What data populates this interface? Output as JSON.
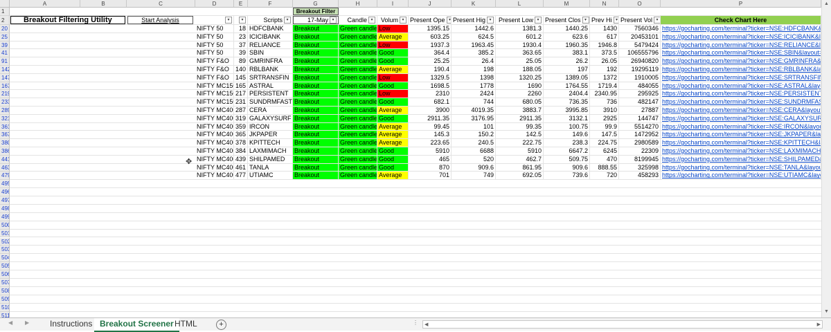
{
  "columns": [
    "A",
    "B",
    "C",
    "D",
    "E",
    "F",
    "G",
    "H",
    "I",
    "J",
    "K",
    "L",
    "M",
    "N",
    "O",
    "P"
  ],
  "row1": {
    "num": "1",
    "breakout_filter": "Breakout Filter"
  },
  "row2": {
    "num": "2",
    "title": "Breakout Filtering Utility",
    "start_button": "Start Analysis",
    "scripts_header": "Scripts",
    "date_header": "17-May",
    "candle_header": "Candle",
    "volume_header": "Volum",
    "open_header": "Present Ope",
    "high_header": "Present Hig",
    "low_header": "Present Low",
    "close_header": "Present Clos",
    "prevhigh_header": "Prev Hi",
    "vol_header": "Present Vol",
    "chart_header": "Check Chart Here"
  },
  "rows": [
    {
      "num": "20",
      "index": "NIFTY 50",
      "n": "18",
      "sym": "HDFCBANK",
      "status": "Breakout",
      "candle": "Green candle",
      "vol": "Low",
      "vc": "red",
      "open": "1395.15",
      "high": "1442.6",
      "low": "1381.3",
      "close": "1440.25",
      "prev": "1430",
      "pvol": "7560346",
      "link": "https://gocharting.com/terminal?ticker=NSE:HDFCBANK&la"
    },
    {
      "num": "25",
      "index": "NIFTY 50",
      "n": "23",
      "sym": "ICICIBANK",
      "status": "Breakout",
      "candle": "Green candle",
      "vol": "Average",
      "vc": "yellow",
      "open": "603.25",
      "high": "624.5",
      "low": "601.2",
      "close": "623.6",
      "prev": "617",
      "pvol": "20453101",
      "link": "https://gocharting.com/terminal?ticker=NSE:ICICIBANK&la"
    },
    {
      "num": "39",
      "index": "NIFTY 50",
      "n": "37",
      "sym": "RELIANCE",
      "status": "Breakout",
      "candle": "Green candle",
      "vol": "Low",
      "vc": "red",
      "open": "1937.3",
      "high": "1963.45",
      "low": "1930.4",
      "close": "1960.35",
      "prev": "1946.8",
      "pvol": "5479424",
      "link": "https://gocharting.com/terminal?ticker=NSE:RELIANCE&lay"
    },
    {
      "num": "41",
      "index": "NIFTY 50",
      "n": "39",
      "sym": "SBIN",
      "status": "Breakout",
      "candle": "Green candle",
      "vol": "Good",
      "vc": "green",
      "open": "364.4",
      "high": "385.2",
      "low": "363.65",
      "close": "383.1",
      "prev": "373.5",
      "pvol": "106555796",
      "link": "https://gocharting.com/terminal?ticker=NSE:SBIN&layout="
    },
    {
      "num": "91",
      "index": "NIFTY F&O",
      "n": "89",
      "sym": "GMRINFRA",
      "status": "Breakout",
      "candle": "Green candle",
      "vol": "Good",
      "vc": "green",
      "open": "25.25",
      "high": "26.4",
      "low": "25.05",
      "close": "26.2",
      "prev": "26.05",
      "pvol": "26940820",
      "link": "https://gocharting.com/terminal?ticker=NSE:GMRINFRA&la"
    },
    {
      "num": "142",
      "index": "NIFTY F&O",
      "n": "140",
      "sym": "RBLBANK",
      "status": "Breakout",
      "candle": "Green candle",
      "vol": "Average",
      "vc": "yellow",
      "open": "190.4",
      "high": "198",
      "low": "188.05",
      "close": "197",
      "prev": "192",
      "pvol": "19295119",
      "link": "https://gocharting.com/terminal?ticker=NSE:RBLBANK&lay"
    },
    {
      "num": "147",
      "index": "NIFTY F&O",
      "n": "145",
      "sym": "SRTRANSFIN",
      "status": "Breakout",
      "candle": "Green candle",
      "vol": "Low",
      "vc": "red",
      "open": "1329.5",
      "high": "1398",
      "low": "1320.25",
      "close": "1389.05",
      "prev": "1372",
      "pvol": "1910005",
      "link": "https://gocharting.com/terminal?ticker=NSE:SRTRANSFIN&"
    },
    {
      "num": "167",
      "index": "NIFTY MC150",
      "n": "165",
      "sym": "ASTRAL",
      "status": "Breakout",
      "candle": "Green candle",
      "vol": "Good",
      "vc": "green",
      "open": "1698.5",
      "high": "1778",
      "low": "1690",
      "close": "1764.55",
      "prev": "1719.4",
      "pvol": "484055",
      "link": "https://gocharting.com/terminal?ticker=NSE:ASTRAL&layo"
    },
    {
      "num": "219",
      "index": "NIFTY MC150",
      "n": "217",
      "sym": "PERSISTENT",
      "status": "Breakout",
      "candle": "Green candle",
      "vol": "Low",
      "vc": "red",
      "open": "2310",
      "high": "2424",
      "low": "2260",
      "close": "2404.4",
      "prev": "2340.95",
      "pvol": "295925",
      "link": "https://gocharting.com/terminal?ticker=NSE:PERSISTENT&"
    },
    {
      "num": "233",
      "index": "NIFTY MC150",
      "n": "231",
      "sym": "SUNDRMFAST",
      "status": "Breakout",
      "candle": "Green candle",
      "vol": "Good",
      "vc": "green",
      "open": "682.1",
      "high": "744",
      "low": "680.05",
      "close": "736.35",
      "prev": "736",
      "pvol": "482147",
      "link": "https://gocharting.com/terminal?ticker=NSE:SUNDRMFAST"
    },
    {
      "num": "289",
      "index": "NIFTY MC400",
      "n": "287",
      "sym": "CERA",
      "status": "Breakout",
      "candle": "Green candle",
      "vol": "Average",
      "vc": "yellow",
      "open": "3900",
      "high": "4019.35",
      "low": "3883.7",
      "close": "3995.85",
      "prev": "3910",
      "pvol": "27887",
      "link": "https://gocharting.com/terminal?ticker=NSE:CERA&layout="
    },
    {
      "num": "321",
      "index": "NIFTY MC400",
      "n": "319",
      "sym": "GALAXYSURF",
      "status": "Breakout",
      "candle": "Green candle",
      "vol": "Good",
      "vc": "green",
      "open": "2911.35",
      "high": "3176.95",
      "low": "2911.35",
      "close": "3132.1",
      "prev": "2925",
      "pvol": "144747",
      "link": "https://gocharting.com/terminal?ticker=NSE:GALAXYSURF&"
    },
    {
      "num": "361",
      "index": "NIFTY MC400",
      "n": "359",
      "sym": "IRCON",
      "status": "Breakout",
      "candle": "Green candle",
      "vol": "Average",
      "vc": "yellow",
      "open": "99.45",
      "high": "101",
      "low": "99.35",
      "close": "100.75",
      "prev": "99.9",
      "pvol": "5514270",
      "link": "https://gocharting.com/terminal?ticker=NSE:IRCON&layou"
    },
    {
      "num": "367",
      "index": "NIFTY MC400",
      "n": "365",
      "sym": "JKPAPER",
      "status": "Breakout",
      "candle": "Green candle",
      "vol": "Average",
      "vc": "yellow",
      "open": "145.3",
      "high": "150.2",
      "low": "142.5",
      "close": "149.6",
      "prev": "147.5",
      "pvol": "1472952",
      "link": "https://gocharting.com/terminal?ticker=NSE:JKPAPER&lay"
    },
    {
      "num": "380",
      "index": "NIFTY MC400",
      "n": "378",
      "sym": "KPITTECH",
      "status": "Breakout",
      "candle": "Green candle",
      "vol": "Average",
      "vc": "yellow",
      "open": "223.65",
      "high": "240.5",
      "low": "222.75",
      "close": "238.3",
      "prev": "224.75",
      "pvol": "2980589",
      "link": "https://gocharting.com/terminal?ticker=NSE:KPITTECH&lay"
    },
    {
      "num": "386",
      "index": "NIFTY MC400",
      "n": "384",
      "sym": "LAXMIMACH",
      "status": "Breakout",
      "candle": "Green candle",
      "vol": "Good",
      "vc": "green",
      "open": "5910",
      "high": "6688",
      "low": "5910",
      "close": "6647.2",
      "prev": "6245",
      "pvol": "22309",
      "link": "https://gocharting.com/terminal?ticker=NSE:LAXMIMACH&"
    },
    {
      "num": "441",
      "index": "NIFTY MC400",
      "n": "439",
      "sym": "SHILPAMED",
      "status": "Breakout",
      "candle": "Green candle",
      "vol": "Good",
      "vc": "green",
      "open": "465",
      "high": "520",
      "low": "462.7",
      "close": "509.75",
      "prev": "470",
      "pvol": "8199945",
      "link": "https://gocharting.com/terminal?ticker=NSE:SHILPAMED&l"
    },
    {
      "num": "463",
      "index": "NIFTY MC400",
      "n": "461",
      "sym": "TANLA",
      "status": "Breakout",
      "candle": "Green candle",
      "vol": "Good",
      "vc": "green",
      "open": "870",
      "high": "909.6",
      "low": "861.95",
      "close": "909.6",
      "prev": "888.55",
      "pvol": "325998",
      "link": "https://gocharting.com/terminal?ticker=NSE:TANLA&layou"
    },
    {
      "num": "479",
      "index": "NIFTY MC400",
      "n": "477",
      "sym": "UTIAMC",
      "status": "Breakout",
      "candle": "Green candle",
      "vol": "Average",
      "vc": "yellow",
      "open": "701",
      "high": "749",
      "low": "692.05",
      "close": "739.6",
      "prev": "720",
      "pvol": "458293",
      "link": "https://gocharting.com/terminal?ticker=NSE:UTIAMC&layo"
    }
  ],
  "empty_rows": [
    "495",
    "496",
    "497",
    "498",
    "499",
    "500",
    "501",
    "502",
    "503",
    "504",
    "505",
    "506",
    "507",
    "508",
    "509",
    "510",
    "511"
  ],
  "tabs": [
    "Instructions",
    "Breakout Screener",
    "HTML"
  ],
  "add_sheet": "+",
  "colors": {
    "green": "#00ff00",
    "red": "#ff0000",
    "yellow": "#ffff00",
    "header_green": "#92d050",
    "link": "#0645c8"
  }
}
